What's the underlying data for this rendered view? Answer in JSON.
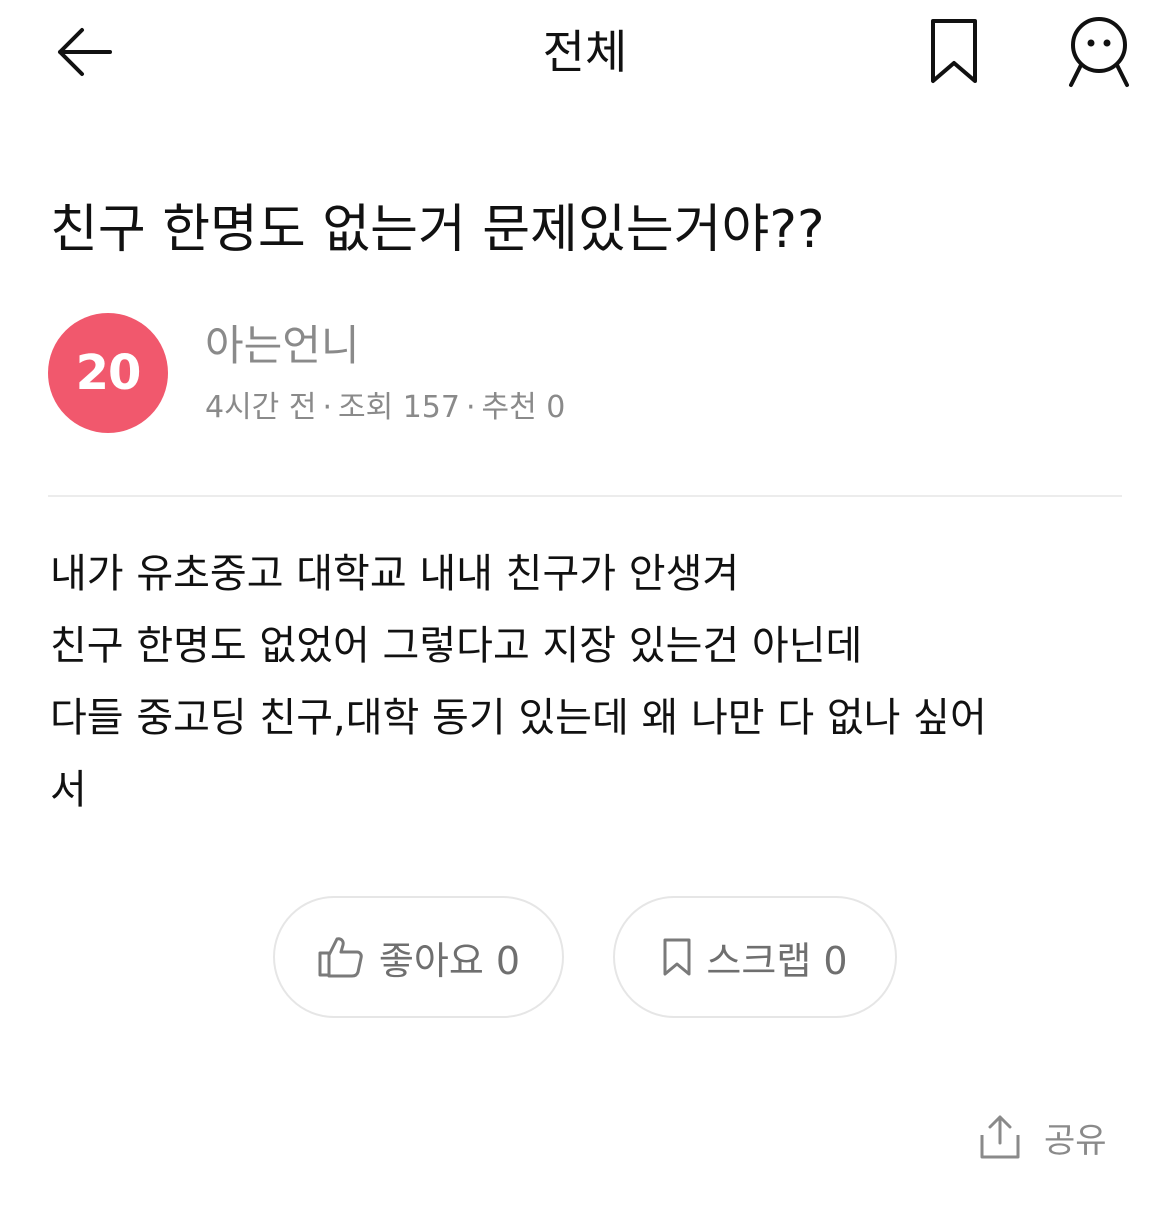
{
  "header": {
    "back_icon": "arrow-left-icon",
    "title": "전체",
    "bookmark_icon": "bookmark-outline-icon",
    "profile_icon": "user-face-icon"
  },
  "post": {
    "title": "친구 한명도 없는거 문제있는거야??",
    "author": {
      "avatar_text": "20",
      "avatar_color": "#f1586d",
      "name": "아는언니"
    },
    "meta": {
      "time": "4시간 전",
      "views": "조회 157",
      "recommends": "추천 0",
      "separator": "·"
    },
    "body_lines": [
      "내가 유초중고 대학교 내내 친구가 안생겨",
      "친구 한명도 없었어 그렇다고 지장 있는건 아닌데",
      "다들 중고딩 친구,대학 동기 있는데 왜 나만 다 없나 싶어",
      "서"
    ]
  },
  "actions": {
    "like_label": "좋아요 0",
    "like_icon": "thumbs-up-icon",
    "scrap_label": "스크랩 0",
    "scrap_icon": "bookmark-small-icon",
    "share_label": "공유",
    "share_icon": "share-upload-icon"
  },
  "colors": {
    "text_primary": "#111111",
    "text_secondary": "#8a8a8a",
    "divider": "#ececec",
    "button_border": "#e6e6e6"
  }
}
